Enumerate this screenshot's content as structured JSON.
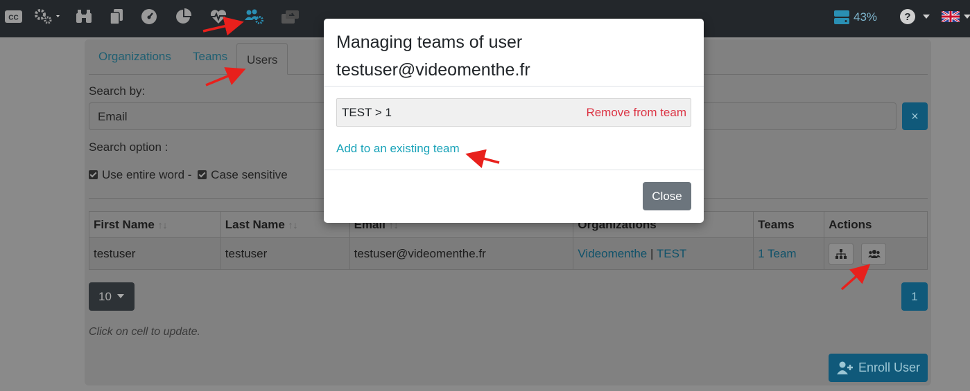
{
  "navbar": {
    "icons": [
      "cc-icon",
      "settings-gears-icon",
      "binoculars-icon",
      "copy-icon",
      "dashboard-gauge-icon",
      "pie-chart-icon",
      "heartbeat-icon",
      "users-settings-icon",
      "transfer-icon"
    ],
    "storage_percent": "43%",
    "help_icon": "question-circle-icon",
    "language_flag": "uk-flag-icon"
  },
  "tabs": [
    "Organizations",
    "Teams",
    "Users"
  ],
  "active_tab": "Users",
  "search": {
    "label": "Search by:",
    "field": "Email",
    "clear_label": "×",
    "option_label": "Search option :",
    "use_entire_word": "Use entire word -",
    "case_sensitive": "Case sensitive"
  },
  "table": {
    "headers": [
      "First Name",
      "Last Name",
      "Email",
      "Organizations",
      "Teams",
      "Actions"
    ],
    "sort_symbol": "↑↓",
    "rows": [
      {
        "first_name": "testuser",
        "last_name": "testuser",
        "email": "testuser@videomenthe.fr",
        "org_1": "Videomenthe",
        "org_sep": "|",
        "org_2": "TEST",
        "teams": "1 Team"
      }
    ]
  },
  "pagination": {
    "page_size": "10",
    "current_page": "1"
  },
  "hint": "Click on cell to update.",
  "enroll_button": "Enroll User",
  "modal": {
    "title_line1": "Managing teams of user",
    "title_line2": "testuser@videomenthe.fr",
    "team_entry": "TEST > 1",
    "remove_label": "Remove from team",
    "add_label": "Add to an existing team",
    "close_label": "Close"
  },
  "colors": {
    "navbar_bg": "#23272b",
    "accent": "#17a2b8",
    "danger": "#dc3545",
    "secondary": "#6c757d",
    "annotation_arrow": "#e8201c"
  }
}
